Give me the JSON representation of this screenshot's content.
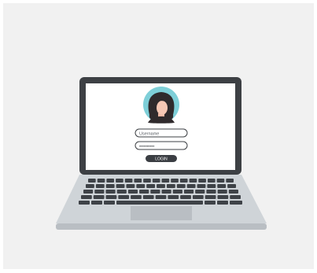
{
  "login_form": {
    "username_placeholder": "Username",
    "password_mask": "••••••••••",
    "login_button_label": "LOGIN"
  },
  "icons": {
    "avatar": "user-avatar-icon",
    "laptop": "laptop-icon"
  },
  "colors": {
    "page_background": "#f1f1f1",
    "laptop_frame": "#3d4044",
    "screen": "#ffffff",
    "avatar_circle": "#7ecfd8",
    "hair": "#2f2a2c",
    "skin": "#f6c7b4",
    "button": "#3b3e43",
    "keyboard_deck": "#cfd4d8",
    "keys": "#3e4247",
    "touchpad": "#b9bec3"
  }
}
